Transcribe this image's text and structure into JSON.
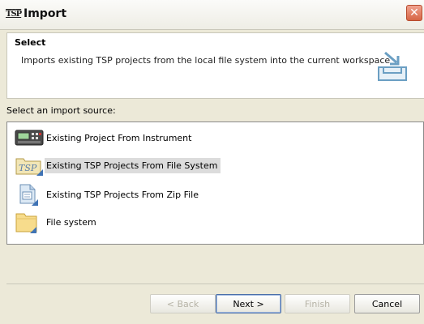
{
  "window": {
    "title": "Import",
    "app_icon_text": "TSP"
  },
  "header": {
    "title": "Select",
    "description": "Imports existing TSP projects from the local file system into the current workspace"
  },
  "source": {
    "label": "Select an import source:",
    "items": [
      {
        "label": "Existing Project From Instrument",
        "icon": "instrument-icon",
        "selected": false
      },
      {
        "label": "Existing TSP Projects From File System",
        "icon": "tsp-folder-icon",
        "selected": true
      },
      {
        "label": "Existing TSP Projects From Zip File",
        "icon": "zip-file-icon",
        "selected": false
      },
      {
        "label": "File system",
        "icon": "folder-icon",
        "selected": false
      }
    ]
  },
  "buttons": {
    "back": "< Back",
    "next": "Next >",
    "finish": "Finish",
    "cancel": "Cancel"
  },
  "colors": {
    "close_button": "#d66545",
    "selection": "#dcdcdc",
    "dialog_bg": "#ece9d8"
  }
}
